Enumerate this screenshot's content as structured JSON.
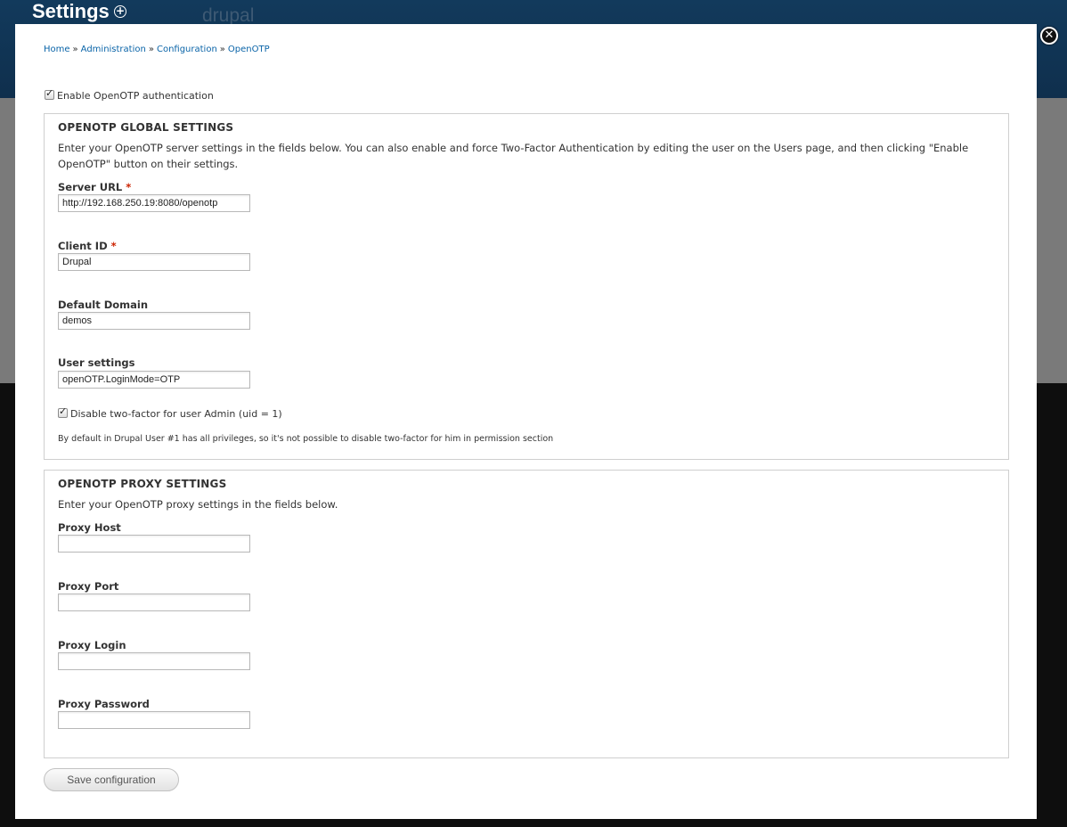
{
  "background": {
    "title": "Settings",
    "plus_icon": "+",
    "logo_text": "drupal"
  },
  "close_icon": "✕",
  "breadcrumb": {
    "items": [
      "Home",
      "Administration",
      "Configuration",
      "OpenOTP"
    ],
    "separator": "»"
  },
  "enable_label": "Enable OpenOTP authentication",
  "global": {
    "legend": "OPENOTP GLOBAL SETTINGS",
    "description": "Enter your OpenOTP server settings in the fields below. You can also enable and force Two-Factor Authentication by editing the user on the Users page, and then clicking \"Enable OpenOTP\" button on their settings.",
    "server_url": {
      "label": "Server URL",
      "value": "http://192.168.250.19:8080/openotp"
    },
    "client_id": {
      "label": "Client ID",
      "value": "Drupal"
    },
    "default_domain": {
      "label": "Default Domain",
      "value": "demos"
    },
    "user_settings": {
      "label": "User settings",
      "value": "openOTP.LoginMode=OTP"
    },
    "disable_admin_label": "Disable two-factor for user Admin (uid = 1)",
    "disable_admin_help": "By default in Drupal User #1 has all privileges, so it's not possible to disable two-factor for him in permission section"
  },
  "required_mark": "*",
  "proxy": {
    "legend": "OPENOTP PROXY SETTINGS",
    "description": "Enter your OpenOTP proxy settings in the fields below.",
    "host": {
      "label": "Proxy Host",
      "value": ""
    },
    "port": {
      "label": "Proxy Port",
      "value": ""
    },
    "login": {
      "label": "Proxy Login",
      "value": ""
    },
    "password": {
      "label": "Proxy Password",
      "value": ""
    }
  },
  "save_label": "Save configuration"
}
